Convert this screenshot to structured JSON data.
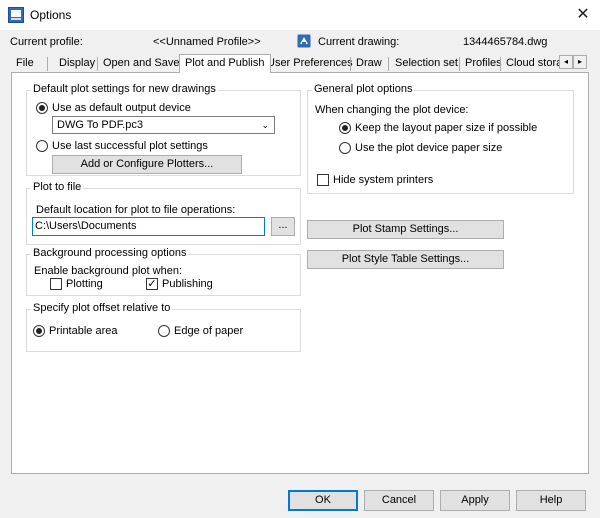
{
  "window": {
    "title": "Options",
    "close_glyph": "✕",
    "icon": "options-app-icon"
  },
  "profile": {
    "current_profile_label": "Current profile:",
    "current_profile_value": "<<Unnamed Profile>>",
    "current_drawing_label": "Current drawing:",
    "current_drawing_value": "1344465784.dwg",
    "drawing_icon": "drawing-file-icon"
  },
  "tabs": [
    "File",
    "Display",
    "Open and Save",
    "Plot and Publish",
    "User Preferences",
    "Draw",
    "Selection set",
    "Profiles",
    "Cloud stora"
  ],
  "active_tab": "Plot and Publish",
  "tab_scroll": {
    "left": "◂",
    "right": "▸"
  },
  "default_plot": {
    "title": "Default plot settings for new drawings",
    "use_default_device": "Use as default output device",
    "device_value": "DWG To PDF.pc3",
    "chevron": "⌄",
    "use_last_successful": "Use last successful plot settings",
    "add_configure_button": "Add or Configure Plotters..."
  },
  "plot_to_file": {
    "title": "Plot to file",
    "default_location_label": "Default location for plot to file operations:",
    "location_value": "C:\\Users\\Documents",
    "browse_button": "..."
  },
  "background": {
    "title": "Background processing options",
    "enable_label": "Enable background plot when:",
    "plotting": "Plotting",
    "publishing": "Publishing",
    "check_glyph": "✓"
  },
  "plot_offset": {
    "title": "Specify plot offset relative to",
    "printable_area": "Printable area",
    "edge_of_paper": "Edge of paper"
  },
  "general_options": {
    "title": "General plot options",
    "when_changing": "When changing the plot device:",
    "keep_layout": "Keep the layout paper size if possible",
    "use_device_paper": "Use the plot device paper size",
    "hide_system_printers": "Hide system printers"
  },
  "buttons": {
    "plot_stamp": "Plot Stamp Settings...",
    "plot_style_table": "Plot Style Table Settings...",
    "ok": "OK",
    "cancel": "Cancel",
    "apply": "Apply",
    "help": "Help"
  },
  "colors": {
    "accent": "#0078d7",
    "icon_blue": "#2d6db5"
  }
}
